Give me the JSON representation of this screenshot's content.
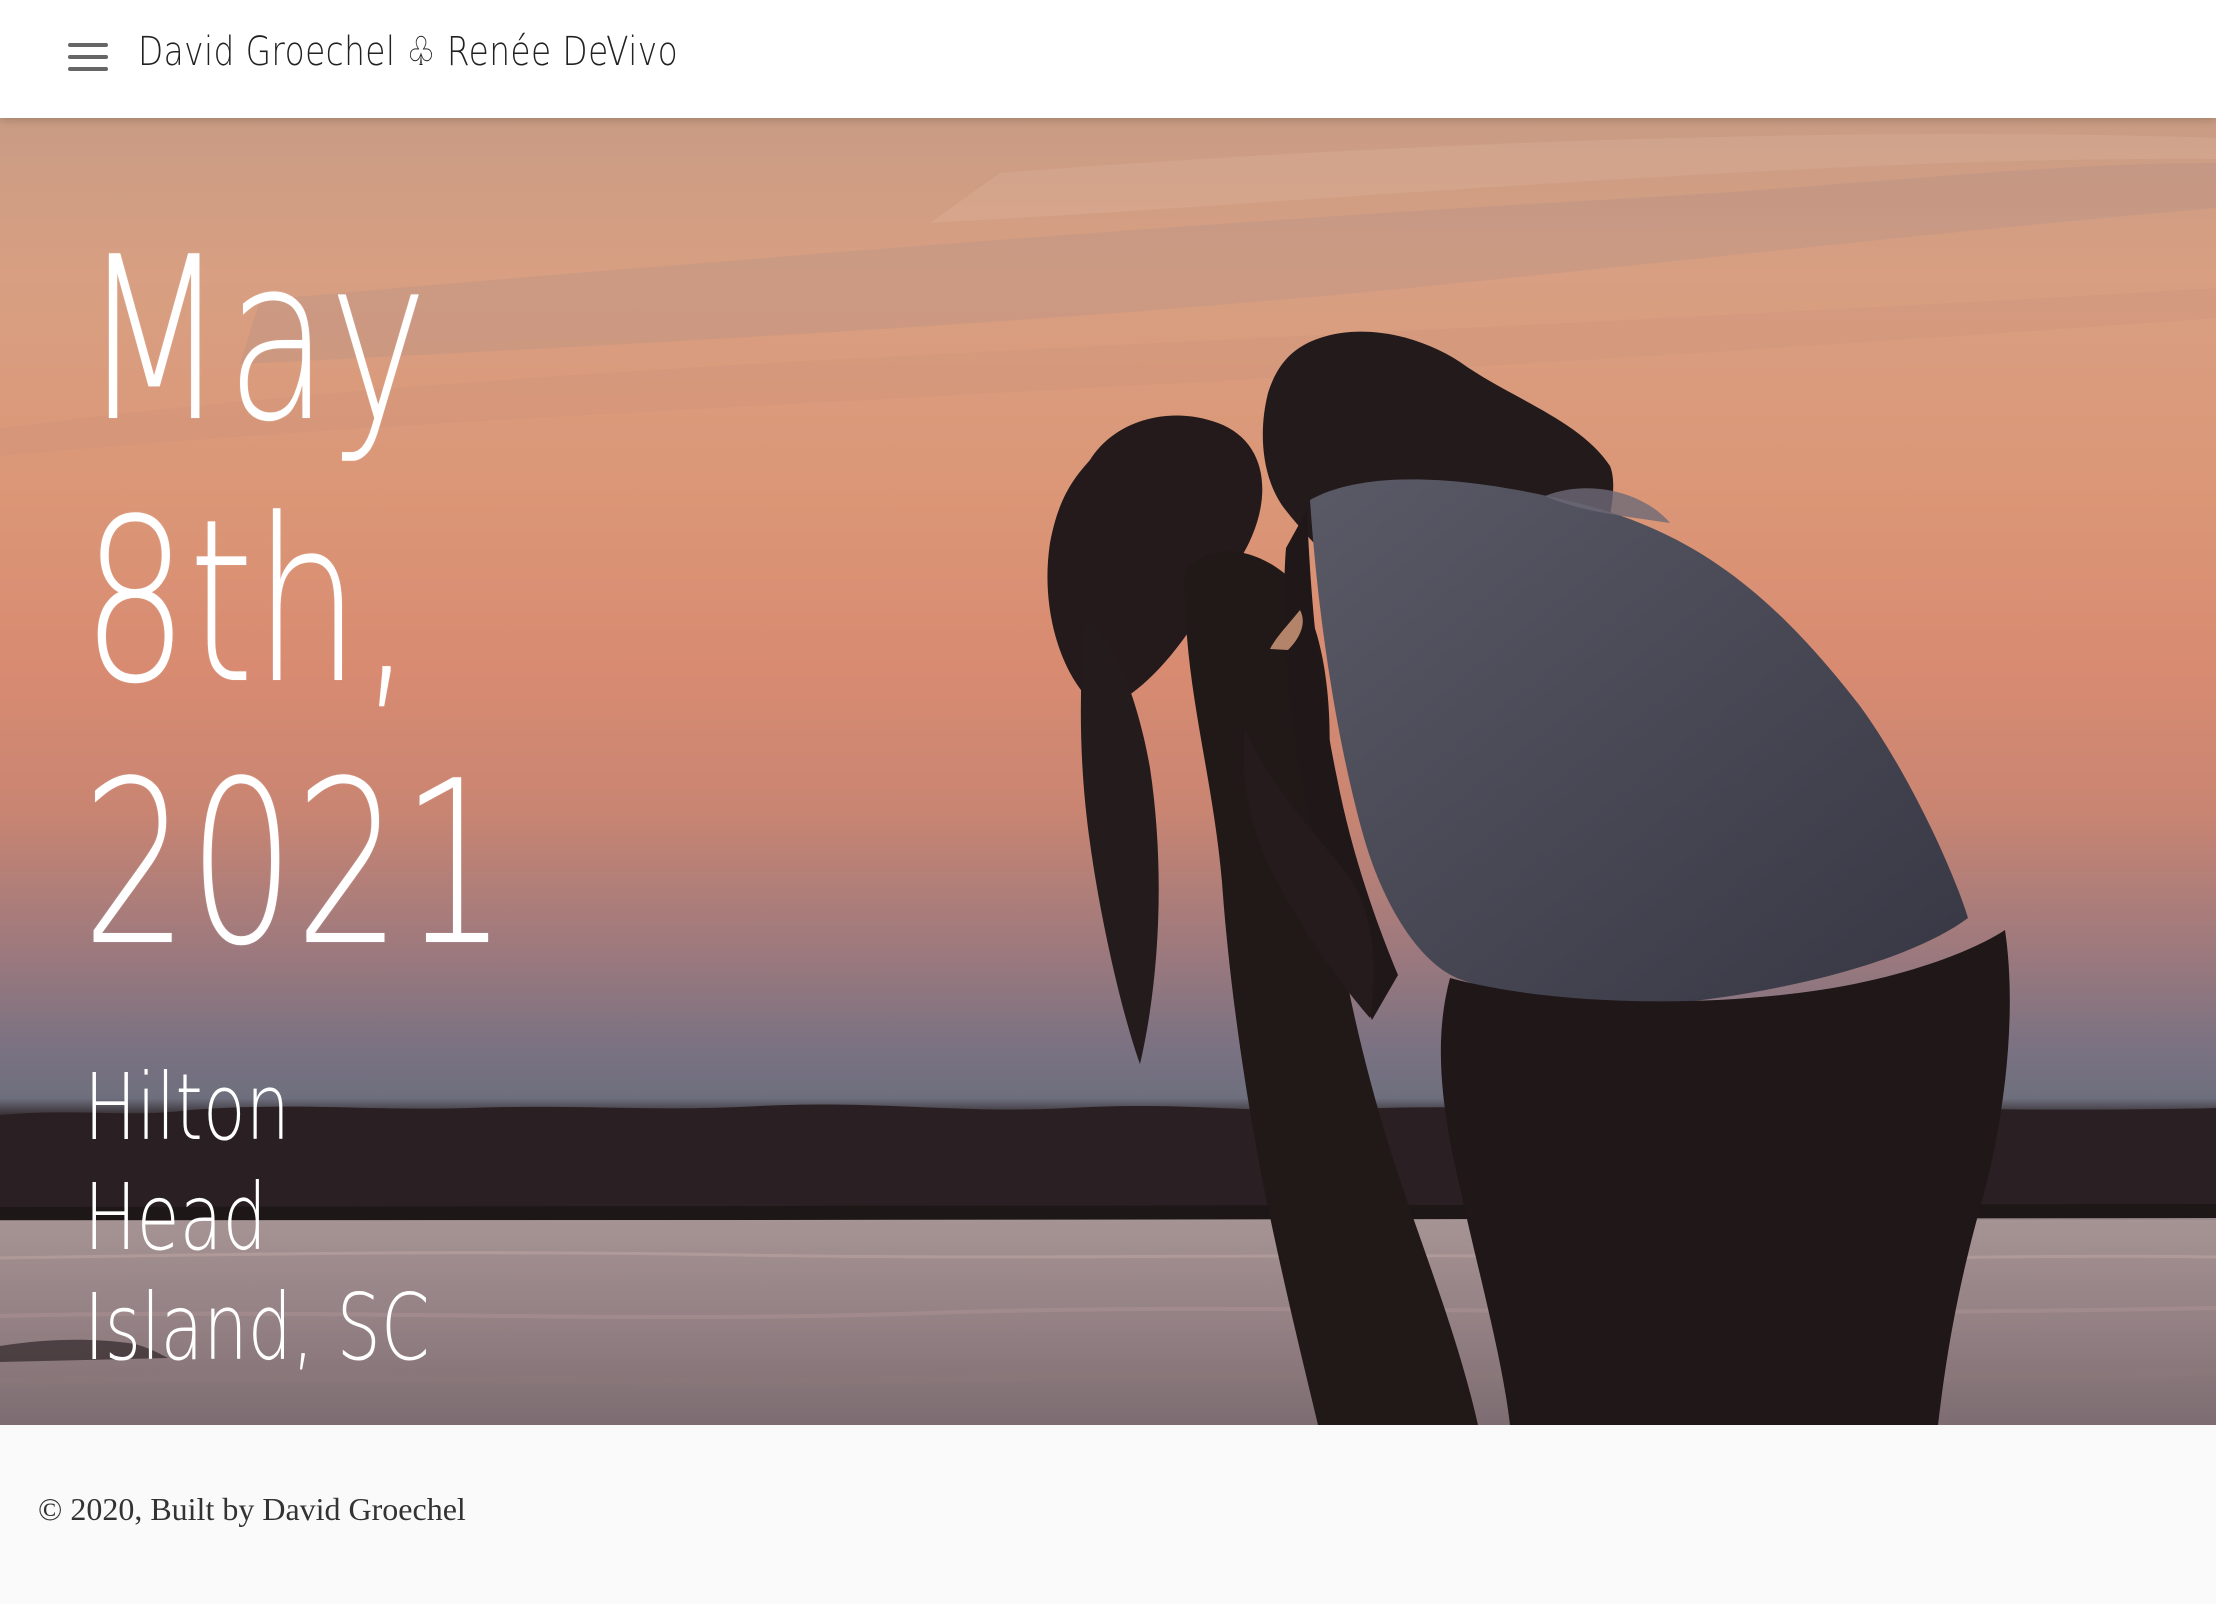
{
  "header": {
    "site_title": "David Groechel ♧ Renée DeVivo",
    "menu_icon": "hamburger-menu-icon"
  },
  "hero": {
    "date_text": "May\n8th,\n2021",
    "location_text": "Hilton Head Island, SC"
  },
  "footer": {
    "copyright": "© 2020, Built by David Groechel"
  },
  "colors": {
    "header_bg": "#ffffff",
    "hero_sky_top": "#c99c84",
    "hero_sky_middle": "#d88b71",
    "hero_horizon": "#6e6f7e",
    "silhouette": "#1f1718",
    "shirt": "#4b4a58",
    "text_on_hero": "#ffffff",
    "footer_bg": "#fafafa"
  }
}
